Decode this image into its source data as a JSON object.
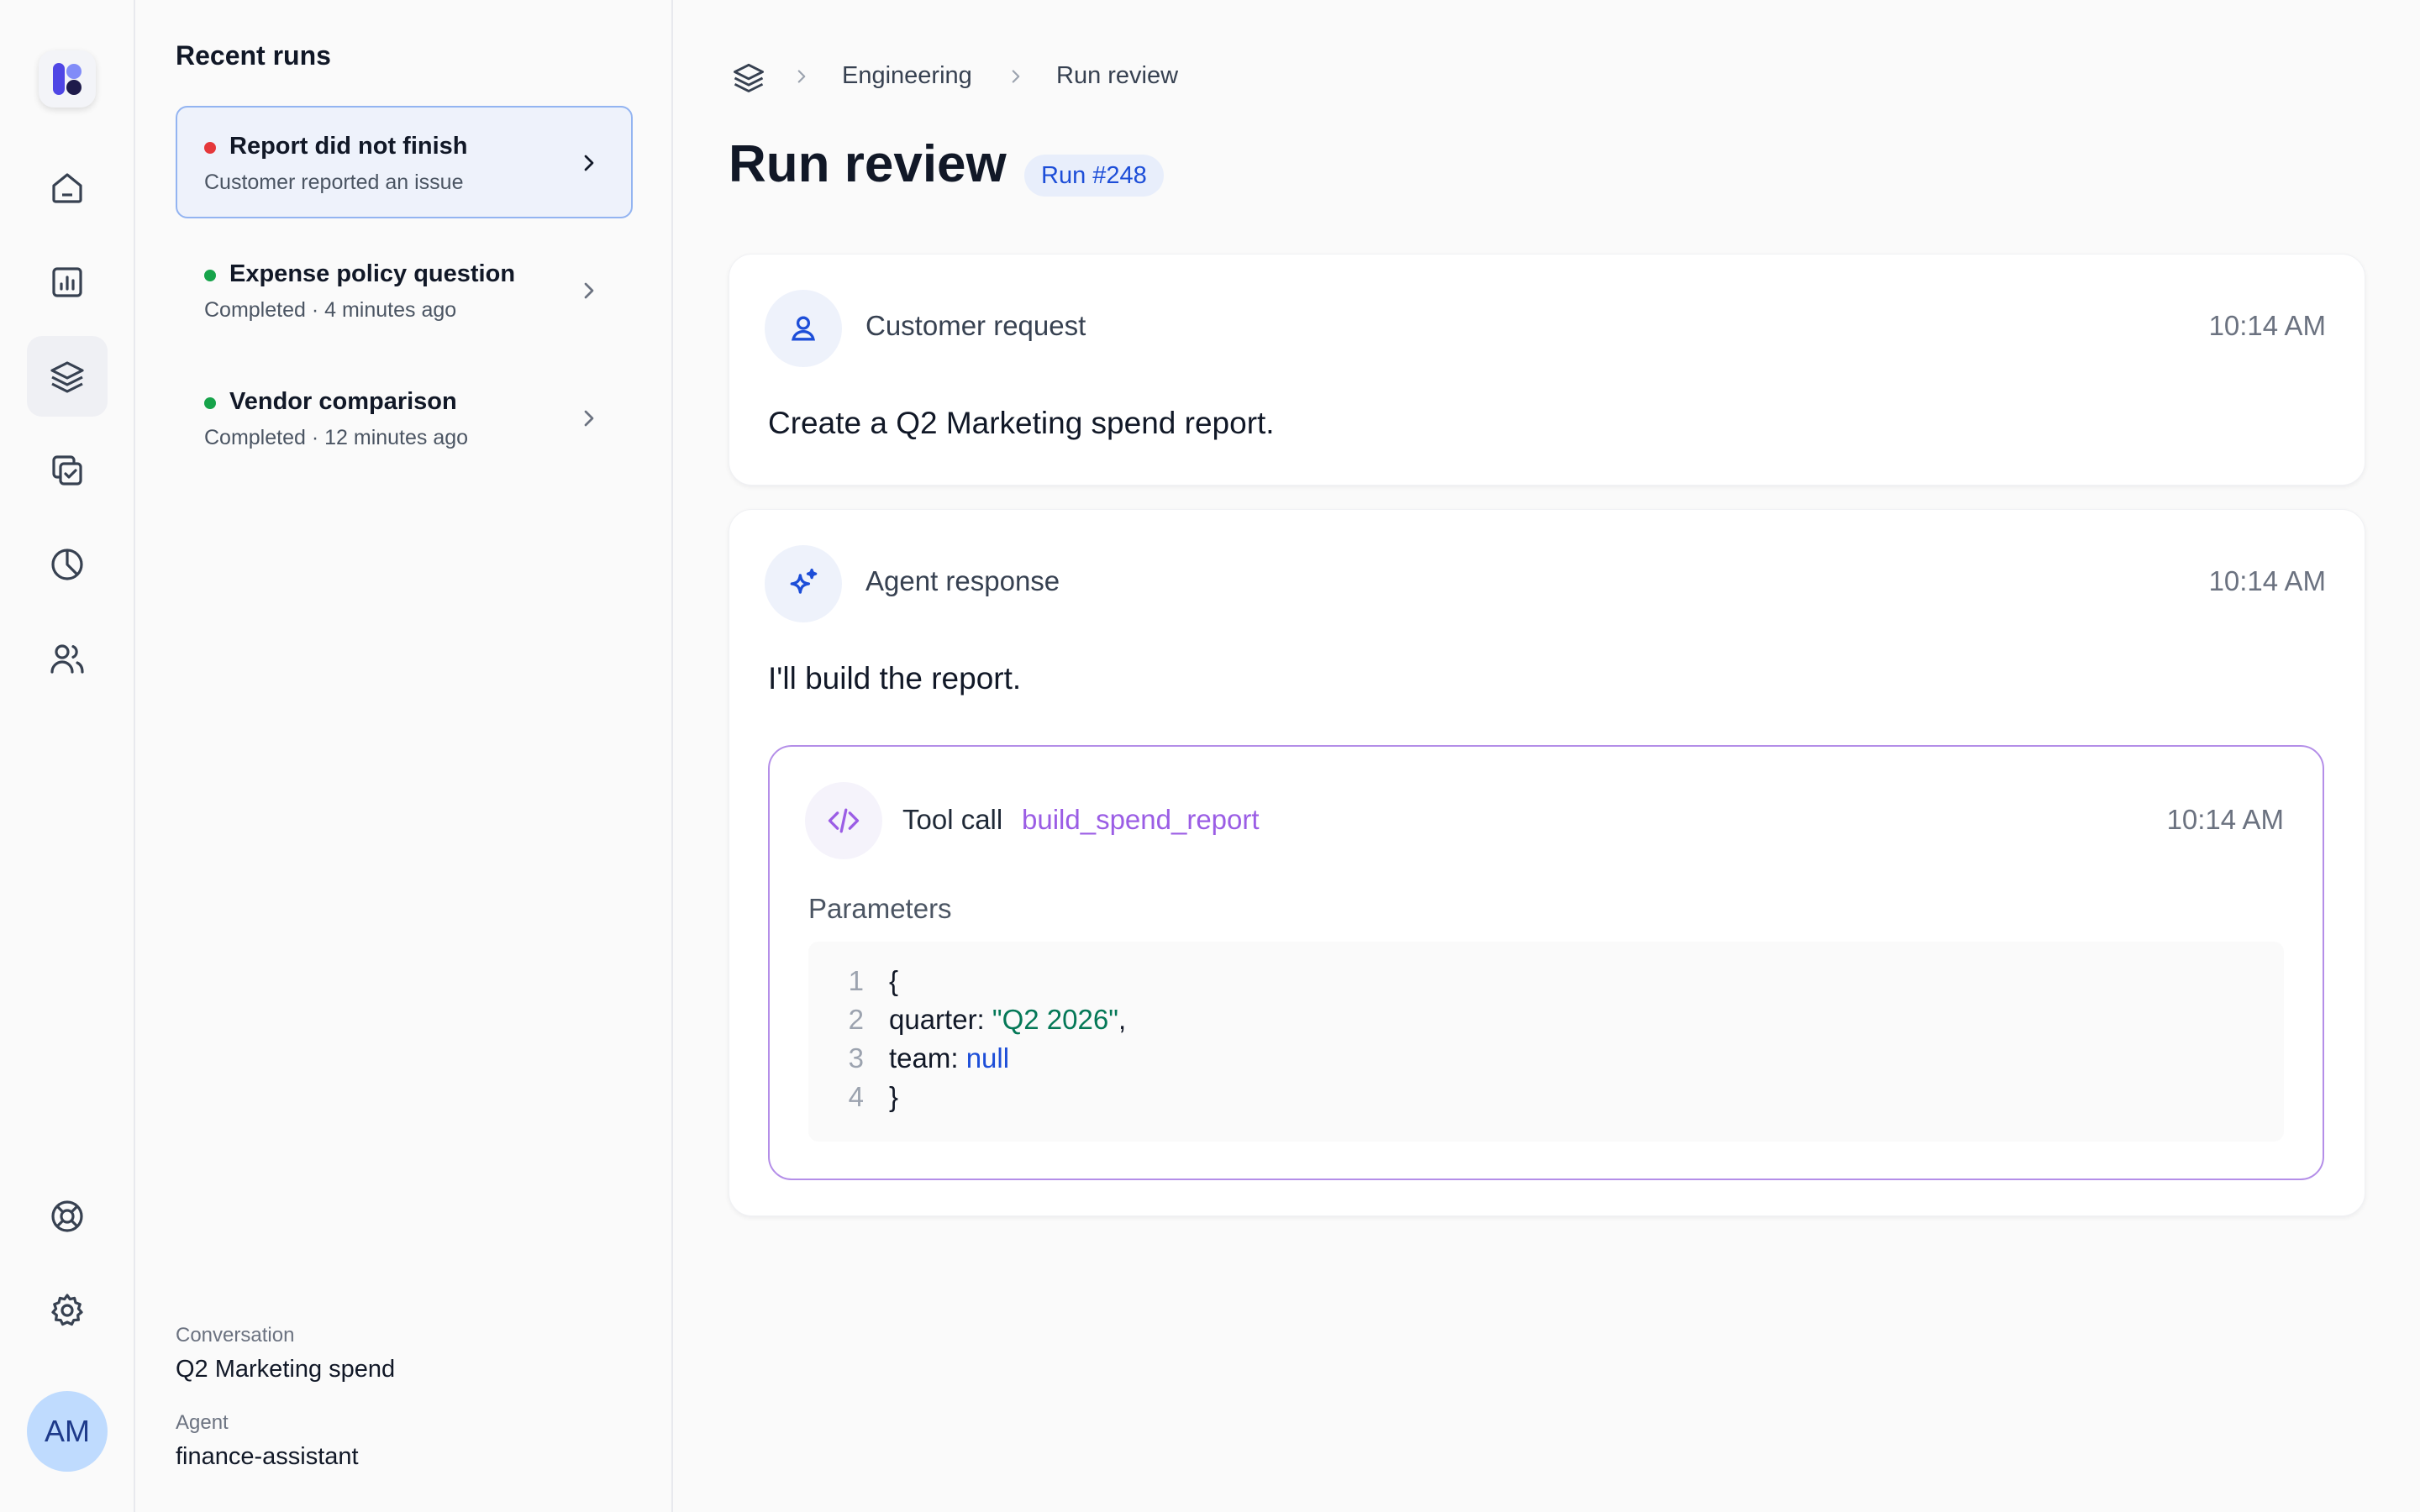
{
  "app": {
    "logo_icon": "brand-logo-icon",
    "avatar_initials": "AM"
  },
  "rail": {
    "items": [
      {
        "name": "home",
        "icon": "home-icon"
      },
      {
        "name": "reports",
        "icon": "bar-chart-icon"
      },
      {
        "name": "runs",
        "icon": "layers-icon",
        "active": true
      },
      {
        "name": "tasks",
        "icon": "check-copy-icon"
      },
      {
        "name": "analytics",
        "icon": "pie-chart-icon"
      },
      {
        "name": "users",
        "icon": "users-icon"
      }
    ],
    "bottom": [
      {
        "name": "support",
        "icon": "lifebuoy-icon"
      },
      {
        "name": "settings",
        "icon": "gear-icon"
      }
    ]
  },
  "runs_panel": {
    "title": "Recent runs",
    "items": [
      {
        "name": "Report did not finish",
        "sub": "Customer reported an issue",
        "status": "error",
        "status_color": "#e5383b",
        "selected": true
      },
      {
        "name": "Expense policy question",
        "sub": "Completed · 4 minutes ago",
        "status": "success",
        "status_color": "#16a34a",
        "selected": false
      },
      {
        "name": "Vendor comparison",
        "sub": "Completed · 12 minutes ago",
        "status": "success",
        "status_color": "#16a34a",
        "selected": false
      }
    ],
    "conversation_label": "Conversation",
    "conversation_value": "Q2 Marketing spend",
    "agent_label": "Agent",
    "agent_value": "finance-assistant"
  },
  "breadcrumb": {
    "icon": "layers-icon",
    "items": [
      "Engineering",
      "Run review"
    ]
  },
  "page": {
    "title": "Run review",
    "badge": "Run #248"
  },
  "request_card": {
    "icon": "user-icon",
    "title": "Customer request",
    "time": "10:14 AM",
    "body": "Create a Q2 Marketing spend report."
  },
  "response_card": {
    "icon": "sparkles-icon",
    "title": "Agent response",
    "time": "10:14 AM",
    "body": "I'll build the report.",
    "tool_call": {
      "icon": "code-icon",
      "label": "Tool call",
      "name": "build_spend_report",
      "time": "10:14 AM",
      "params_label": "Parameters",
      "lines": [
        {
          "n": "1",
          "parts": [
            {
              "t": "{",
              "c": ""
            }
          ]
        },
        {
          "n": "2",
          "parts": [
            {
              "t": "quarter: ",
              "c": ""
            },
            {
              "t": "\"Q2 2026\"",
              "c": "str"
            },
            {
              "t": ",",
              "c": ""
            }
          ]
        },
        {
          "n": "3",
          "parts": [
            {
              "t": "team: ",
              "c": ""
            },
            {
              "t": "null",
              "c": "kw"
            }
          ]
        },
        {
          "n": "4",
          "parts": [
            {
              "t": "}",
              "c": ""
            }
          ]
        }
      ]
    }
  },
  "colors": {
    "accent": "#1d4ed8",
    "tool_accent": "#9b5de5",
    "tool_border": "#b48ee8",
    "string": "#047857"
  }
}
